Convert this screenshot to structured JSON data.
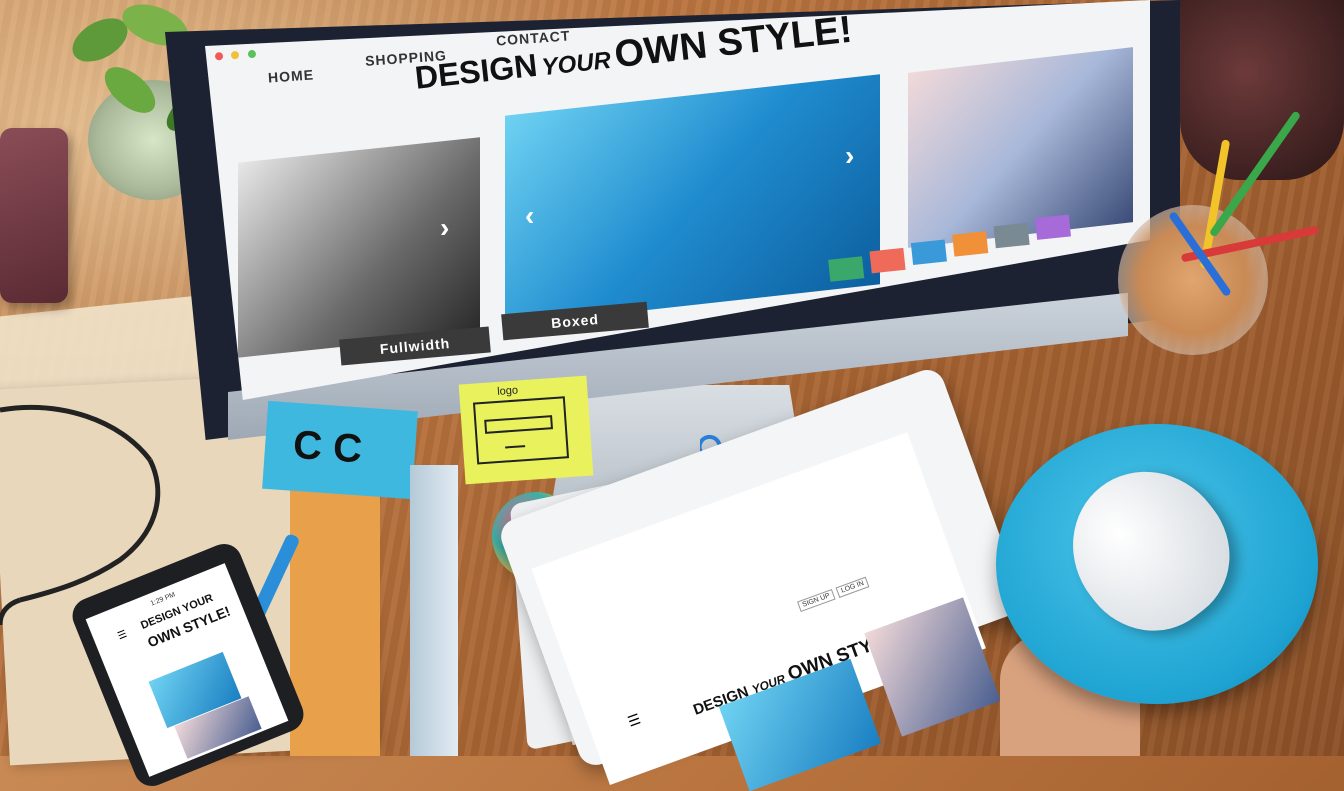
{
  "monitor": {
    "nav": {
      "home": "HOME",
      "shopping": "SHOPPING",
      "contact": "CONTACT"
    },
    "hero": {
      "design": "DESIGN",
      "your": "YOUR",
      "own_style": "OWN STYLE!"
    },
    "buttons": {
      "fullwidth": "Fullwidth",
      "boxed": "Boxed"
    },
    "arrows": {
      "prev": "‹",
      "next": "›"
    },
    "swatches": [
      "#3aa86b",
      "#f06a5a",
      "#3a9ad9",
      "#f0913a",
      "#7a8a93",
      "#a66bd9"
    ]
  },
  "sticky_notes": {
    "blue_text": "C C",
    "yellow_text": "logo"
  },
  "tablet": {
    "buttons": {
      "signup": "SIGN UP",
      "login": "LOG IN"
    },
    "hero": {
      "design": "DESIGN",
      "your": "YOUR",
      "own_style": "OWN STYLE!"
    }
  },
  "phone": {
    "status": "1:29 PM",
    "hero": {
      "design_your": "DESIGN YOUR",
      "own_style": "OWN STYLE!"
    }
  },
  "colors": {
    "screen_bg": "#f3f4f6",
    "mouse_pad": "#1ea3d2",
    "sticky_blue": "#3fb8df",
    "sticky_yellow": "#e9f25c"
  }
}
